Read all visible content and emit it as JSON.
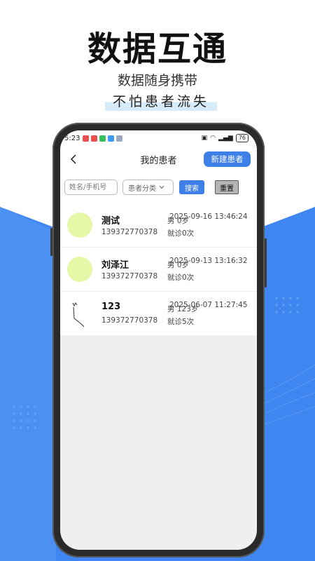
{
  "promo": {
    "headline": "数据互通",
    "subtitle": "数据随身携带",
    "tagline": "不怕患者流失"
  },
  "statusbar": {
    "time": "5:23",
    "battery": "76"
  },
  "navbar": {
    "title": "我的患者",
    "new_patient_label": "新建患者"
  },
  "filters": {
    "search_placeholder": "姓名/手机号",
    "category_label": "患者分类",
    "search_label": "搜索",
    "reset_label": "重置"
  },
  "patients": [
    {
      "name": "测试",
      "phone": "139372770378",
      "gender_age": "男 0岁",
      "last_visit": "2025-09-16 13:46:24",
      "visits": "就诊0次",
      "avatar": "circle"
    },
    {
      "name": "刘泽江",
      "phone": "139372770378",
      "gender_age": "男 0岁",
      "last_visit": "2025-09-13 13:16:32",
      "visits": "就诊0次",
      "avatar": "circle"
    },
    {
      "name": "123",
      "phone": "139372770378",
      "gender_age": "男 123岁",
      "last_visit": "2025-06-07 11:27:45",
      "visits": "就诊5次",
      "avatar": "sketch"
    }
  ],
  "colors": {
    "accent": "#3f7fe8",
    "background_blue": "#3f86f0",
    "avatar_fill": "#e6f7a8"
  }
}
